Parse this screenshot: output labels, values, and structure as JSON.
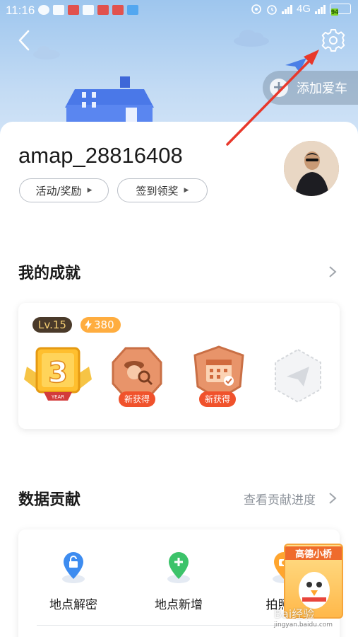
{
  "status_bar": {
    "time": "11:16",
    "network": "4G",
    "battery": "94"
  },
  "header": {
    "add_car_label": "添加爱车"
  },
  "profile": {
    "username": "amap_28816408",
    "activity_button": "活动/奖励",
    "checkin_button": "签到领奖"
  },
  "achievements": {
    "title": "我的成就",
    "level": "Lv.15",
    "points": "380",
    "badges": [
      {
        "icon": "year-3-badge",
        "label": "YEAR",
        "number": "3"
      },
      {
        "icon": "explorer-badge",
        "tag": "新获得"
      },
      {
        "icon": "calendar-badge",
        "tag": "新获得"
      },
      {
        "icon": "paper-plane-badge-locked"
      }
    ]
  },
  "contribution": {
    "title": "数据贡献",
    "progress_link": "查看贡献进度",
    "items": [
      {
        "label": "地点解密",
        "icon": "unlock-pin-icon",
        "color": "#3d8cf0"
      },
      {
        "label": "地点新增",
        "icon": "plus-pin-icon",
        "color": "#3cc36a"
      },
      {
        "label": "拍照验",
        "icon": "camera-pin-icon",
        "color": "#ffa52e"
      }
    ]
  },
  "promo": {
    "title": "高德小桥"
  },
  "watermark": {
    "text": "Bai经验",
    "sub": "jingyan.baidu.com"
  },
  "colors": {
    "hero_top": "#9ec6ee",
    "annotation_arrow": "#e8382b",
    "new_tag": "#f0522c",
    "points_badge": "#ffad3f"
  }
}
